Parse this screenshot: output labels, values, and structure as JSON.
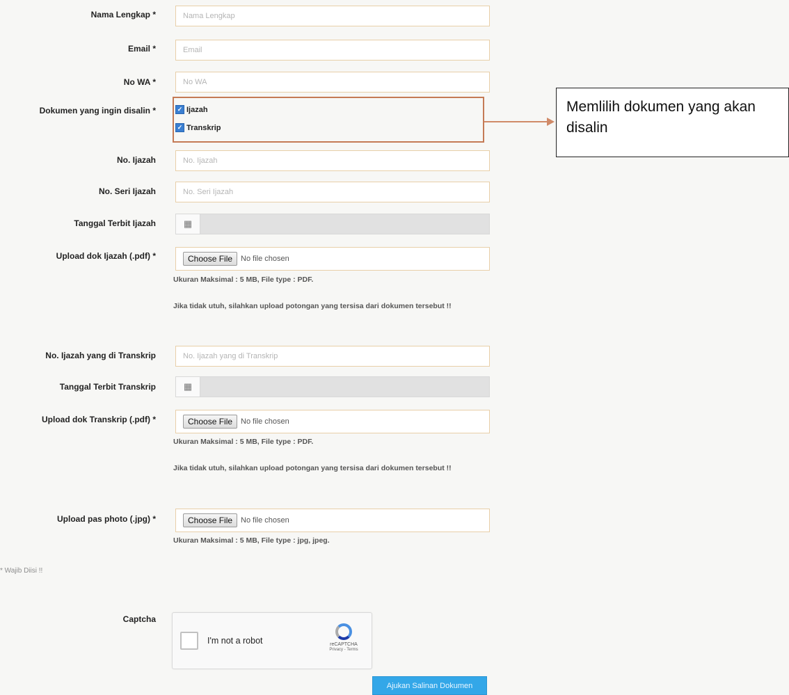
{
  "form": {
    "nama": {
      "label": "Nama Lengkap *",
      "placeholder": "Nama Lengkap"
    },
    "email": {
      "label": "Email *",
      "placeholder": "Email"
    },
    "wa": {
      "label": "No WA *",
      "placeholder": "No WA"
    },
    "dokumen": {
      "label": "Dokumen yang ingin disalin *",
      "options": [
        {
          "label": "Ijazah",
          "checked": true
        },
        {
          "label": "Transkrip",
          "checked": true
        }
      ]
    },
    "no_ijazah": {
      "label": "No. Ijazah",
      "placeholder": "No. Ijazah"
    },
    "no_seri": {
      "label": "No. Seri Ijazah",
      "placeholder": "No. Seri Ijazah"
    },
    "tgl_ijazah": {
      "label": "Tanggal Terbit Ijazah",
      "icon": "calendar-icon"
    },
    "upload_ijazah": {
      "label": "Upload dok Ijazah (.pdf) *",
      "button": "Choose File",
      "status": "No file chosen",
      "help": "Ukuran Maksimal : 5 MB, File type : PDF.",
      "note": "Jika tidak utuh, silahkan upload potongan yang tersisa dari dokumen tersebut !!"
    },
    "no_ijazah_transkrip": {
      "label": "No. Ijazah yang di Transkrip",
      "placeholder": "No. Ijazah yang di Transkrip"
    },
    "tgl_transkrip": {
      "label": "Tanggal Terbit Transkrip",
      "icon": "calendar-icon"
    },
    "upload_transkrip": {
      "label": "Upload dok Transkrip (.pdf) *",
      "button": "Choose File",
      "status": "No file chosen",
      "help": "Ukuran Maksimal : 5 MB, File type : PDF.",
      "note": "Jika tidak utuh, silahkan upload potongan yang tersisa dari dokumen tersebut !!"
    },
    "upload_photo": {
      "label": "Upload pas photo (.jpg) *",
      "button": "Choose File",
      "status": "No file chosen",
      "help": "Ukuran Maksimal : 5 MB, File type : jpg, jpeg."
    },
    "required_note": "* Wajib Diisi !!",
    "captcha": {
      "label": "Captcha",
      "text": "I'm not a robot",
      "brand": "reCAPTCHA",
      "links": "Privacy - Terms"
    },
    "submit": "Ajukan Salinan Dokumen"
  },
  "annotation": {
    "callout": "Memlilih dokumen yang akan disalin",
    "highlight_color": "#c47a55",
    "arrow_color": "#d08a68"
  },
  "colors": {
    "input_border": "#e8cfa8",
    "checkbox": "#3b7fd1",
    "submit_bg": "#33a7e8"
  }
}
